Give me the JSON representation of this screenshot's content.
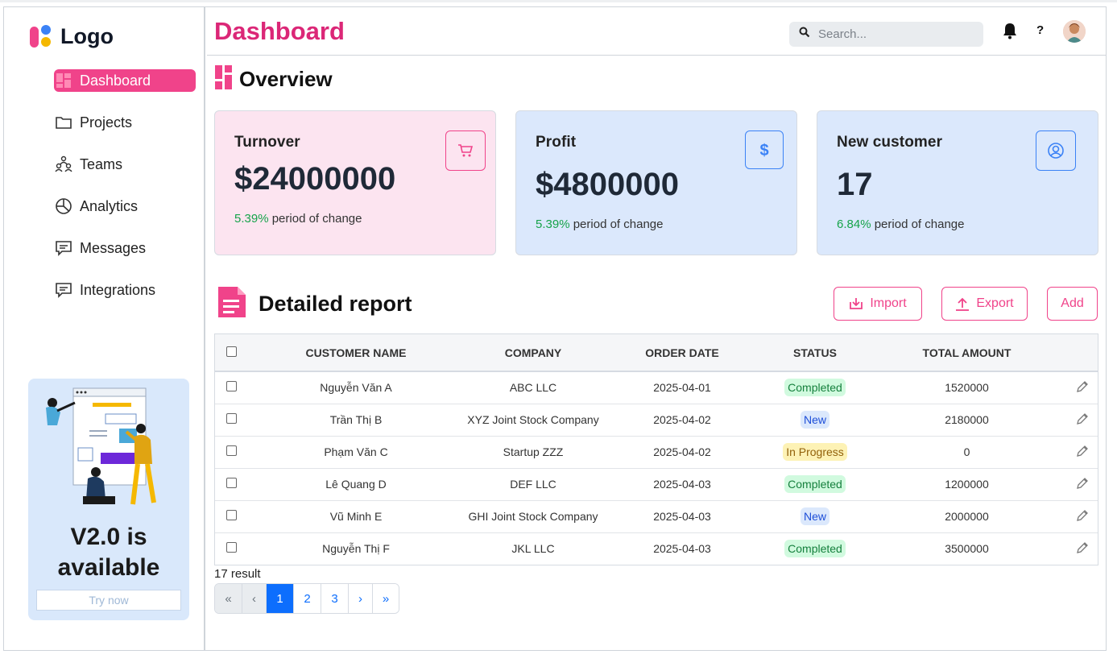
{
  "brand": {
    "logo_text": "Logo"
  },
  "sidebar": {
    "items": [
      {
        "label": "Dashboard",
        "icon": "dashboard-icon",
        "active": true
      },
      {
        "label": "Projects",
        "icon": "folder-icon"
      },
      {
        "label": "Teams",
        "icon": "teams-icon"
      },
      {
        "label": "Analytics",
        "icon": "pie-chart-icon"
      },
      {
        "label": "Messages",
        "icon": "message-icon"
      },
      {
        "label": "Integrations",
        "icon": "message-icon"
      }
    ],
    "promo": {
      "title": "V2.0 is\navailable",
      "button": "Try now"
    }
  },
  "header": {
    "title": "Dashboard",
    "search_placeholder": "Search...",
    "help": "?"
  },
  "overview": {
    "title": "Overview",
    "cards": [
      {
        "label": "Turnover",
        "value": "$24000000",
        "change": "5.39%",
        "change_text": " period of change",
        "icon": "cart-icon",
        "color": "#f0438a"
      },
      {
        "label": "Profit",
        "value": "$4800000",
        "change": "5.39%",
        "change_text": " period of change",
        "icon": "dollar-icon",
        "color": "#3b82f6"
      },
      {
        "label": "New customer",
        "value": "17",
        "change": "6.84%",
        "change_text": " period of change",
        "icon": "user-circle-icon",
        "color": "#3b82f6"
      }
    ]
  },
  "report": {
    "title": "Detailed report",
    "buttons": {
      "import": "Import",
      "export": "Export",
      "add": "Add"
    },
    "columns": [
      "CUSTOMER NAME",
      "COMPANY",
      "ORDER DATE",
      "STATUS",
      "TOTAL AMOUNT"
    ],
    "rows": [
      {
        "name": "Nguyễn Văn A",
        "company": "ABC LLC",
        "date": "2025-04-01",
        "status": "Completed",
        "amount": "1520000"
      },
      {
        "name": "Trần Thị B",
        "company": "XYZ Joint Stock Company",
        "date": "2025-04-02",
        "status": "New",
        "amount": "2180000"
      },
      {
        "name": "Phạm Văn C",
        "company": "Startup ZZZ",
        "date": "2025-04-02",
        "status": "In Progress",
        "amount": "0"
      },
      {
        "name": "Lê Quang D",
        "company": "DEF LLC",
        "date": "2025-04-03",
        "status": "Completed",
        "amount": "1200000"
      },
      {
        "name": "Vũ Minh E",
        "company": "GHI Joint Stock Company",
        "date": "2025-04-03",
        "status": "New",
        "amount": "2000000"
      },
      {
        "name": "Nguyễn Thị F",
        "company": "JKL LLC",
        "date": "2025-04-03",
        "status": "Completed",
        "amount": "3500000"
      }
    ],
    "result_count": "17 result",
    "pagination": [
      "«",
      "‹",
      "1",
      "2",
      "3",
      "›",
      "»"
    ],
    "current_page": "1"
  },
  "colors": {
    "accent_pink": "#f0438a",
    "title_pink": "#db2777",
    "blue": "#3b82f6",
    "success": "#16a34a"
  }
}
